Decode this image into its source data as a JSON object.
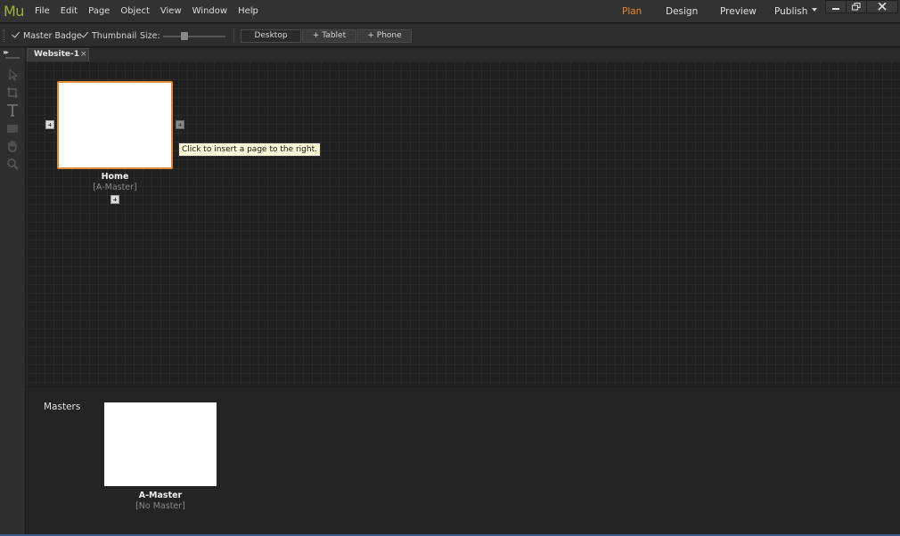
{
  "app": {
    "logo": "Mu"
  },
  "menu": [
    "File",
    "Edit",
    "Page",
    "Object",
    "View",
    "Window",
    "Help"
  ],
  "modes": {
    "plan": "Plan",
    "design": "Design",
    "preview": "Preview",
    "publish": "Publish"
  },
  "colors": {
    "accent": "#e8862a",
    "logo": "#9db240",
    "page_selected_border": "#e08a33"
  },
  "toolbar": {
    "master_badge": "Master Badge",
    "thumbnail": "Thumbnail",
    "size_label": "Size:",
    "desktop": "Desktop",
    "tablet": "+ Tablet",
    "phone": "+ Phone"
  },
  "tabs": [
    {
      "label": "Website-1",
      "close": "×"
    }
  ],
  "tools": [
    "selection-icon",
    "crop-icon",
    "text-icon",
    "rectangle-icon",
    "hand-icon",
    "zoom-icon"
  ],
  "plan": {
    "page_title": "Home",
    "page_master": "[A-Master]",
    "tooltip": "Click to insert a page to the right."
  },
  "masters": {
    "label": "Masters",
    "name": "A-Master",
    "sub": "[No Master]"
  }
}
